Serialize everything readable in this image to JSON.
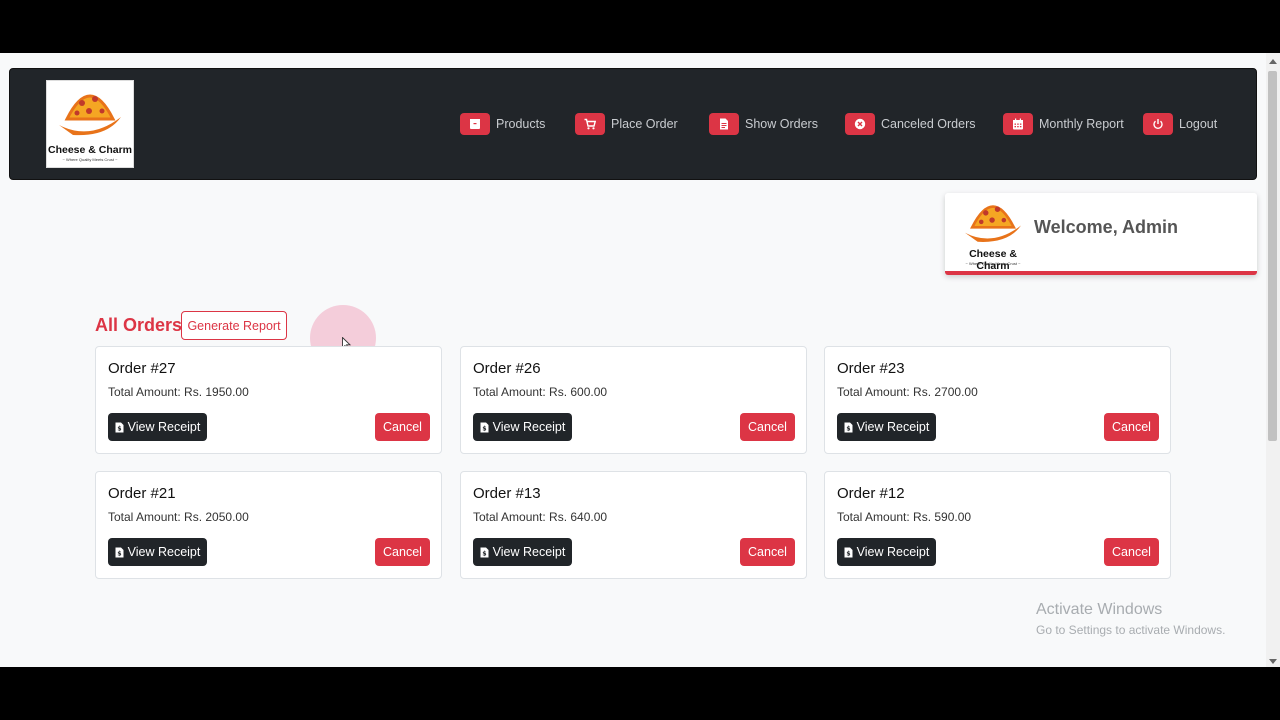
{
  "brand": {
    "name": "Cheese & Charm",
    "tagline": "~ Where Quality Meets Crust ~",
    "accent_color": "#dc3545",
    "logo_colors": [
      "#f5a623",
      "#e8731a",
      "#c0392b"
    ]
  },
  "nav": {
    "items": [
      {
        "label": "Products",
        "icon": "box-icon"
      },
      {
        "label": "Place Order",
        "icon": "cart-icon"
      },
      {
        "label": "Show Orders",
        "icon": "file-icon"
      },
      {
        "label": "Canceled Orders",
        "icon": "times-circle-icon"
      },
      {
        "label": "Monthly Report",
        "icon": "calendar-icon"
      },
      {
        "label": "Logout",
        "icon": "power-icon"
      }
    ]
  },
  "welcome": {
    "text": "Welcome, Admin"
  },
  "orders_section": {
    "title": "All Orders",
    "generate_report_label": "Generate Report"
  },
  "orders": [
    {
      "title": "Order #27",
      "total": "Total Amount: Rs. 1950.00",
      "receipt_label": "View Receipt",
      "cancel_label": "Cancel"
    },
    {
      "title": "Order #26",
      "total": "Total Amount: Rs. 600.00",
      "receipt_label": "View Receipt",
      "cancel_label": "Cancel"
    },
    {
      "title": "Order #23",
      "total": "Total Amount: Rs. 2700.00",
      "receipt_label": "View Receipt",
      "cancel_label": "Cancel"
    },
    {
      "title": "Order #21",
      "total": "Total Amount: Rs. 2050.00",
      "receipt_label": "View Receipt",
      "cancel_label": "Cancel"
    },
    {
      "title": "Order #13",
      "total": "Total Amount: Rs. 640.00",
      "receipt_label": "View Receipt",
      "cancel_label": "Cancel"
    },
    {
      "title": "Order #12",
      "total": "Total Amount: Rs. 590.00",
      "receipt_label": "View Receipt",
      "cancel_label": "Cancel"
    }
  ],
  "watermark": {
    "line1": "Activate Windows",
    "line2": "Go to Settings to activate Windows."
  }
}
